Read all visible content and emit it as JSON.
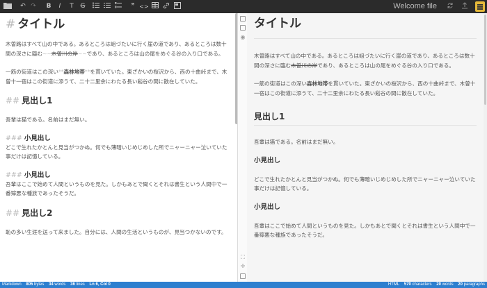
{
  "toolbar": {
    "title": "Welcome file",
    "icons": [
      "folder-icon",
      "undo-icon",
      "redo-icon",
      "bold-icon",
      "italic-icon",
      "heading-icon",
      "strikethrough-icon",
      "unordered-list-icon",
      "ordered-list-icon",
      "checklist-icon",
      "quote-icon",
      "code-icon",
      "table-icon",
      "link-icon",
      "image-icon",
      "sync-icon",
      "publish-icon",
      "menu-icon"
    ],
    "glyphs": {
      "bold": "B",
      "italic": "I",
      "heading": "T",
      "strike": "G",
      "quote": "❞",
      "code": "<>",
      "undo": "↶",
      "redo": "↷"
    }
  },
  "editor": {
    "h1_mark": "#",
    "h1": "タイトル",
    "p1_a": "木曽路はすべて山の中である。あるところは岨づたいに行く崖の道であり、あるところは数十間の深さに臨む",
    "p1_strike_mark_open": "~~",
    "p1_strike": "木曽川の岸",
    "p1_strike_mark_close": "~~",
    "p1_b": "であり、あるところは山の尾をめぐる谷の入り口である。",
    "p2_a": "一筋の街道はこの深い",
    "p2_bold_open": "**",
    "p2_bold": "森林地帯",
    "p2_bold_close": "**",
    "p2_b": "を貫いていた。東ざかいの桜沢から、西の十曲峠まで、木曽十一宿はこの街道に添うて、二十二里余にわたる長い谿谷の間に散在していた。",
    "h2a_mark": "##",
    "h2a": "見出し1",
    "p3": "吾輩は猫である。名前はまだ無い。",
    "h3a_mark": "###",
    "h3a": "小見出し",
    "p4": "どこで生れたかとんと見当がつかぬ。何でも薄暗いじめじめした所でニャーニャー泣いていた事だけは記憶している。",
    "h3b_mark": "###",
    "h3b": "小見出し",
    "p5": "吾輩はここで始めて人間というものを見た。しかもあとで聞くとそれは書生という人間中で一番獰悪な種族であったそうだ。",
    "h2b_mark": "##",
    "h2b": "見出し2",
    "p6": "恥の多い生涯を送って来ました。自分には、人間の生活というものが、見当つかないのです。"
  },
  "preview": {
    "h1": "タイトル",
    "p1_a": "木曽路はすべて山の中である。あるところは岨づたいに行く崖の道であり、あるところは数十間の深さに臨む",
    "p1_strike": "木曽川の岸",
    "p1_b": "であり、あるところは山の尾をめぐる谷の入り口である。",
    "p2_a": "一筋の街道はこの深い",
    "p2_bold": "森林地帯",
    "p2_b": "を貫いていた。東ざかいの桜沢から、西の十曲峠まで、木曽十一宿はこの街道に添うて、二十二里余にわたる長い谿谷の間に散在していた。",
    "h2a": "見出し1",
    "p3": "吾輩は猫である。名前はまだ無い。",
    "h3a": "小見出し",
    "p4": "どこで生れたかとんと見当がつかぬ。何でも薄暗いじめじめした所でニャーニャー泣いていた事だけは記憶している。",
    "h3b": "小見出し",
    "p5": "吾輩はここで始めて人間というものを見た。しかもあとで聞くとそれは書生という人間中で一番獰悪な種族であったそうだ。"
  },
  "statusbar": {
    "mode": "Markdown",
    "bytes_n": "805",
    "bytes_l": "bytes",
    "words_n": "34",
    "words_l": "words",
    "lines_n": "36",
    "lines_l": "lines",
    "cursor": "Ln 6, Col 0",
    "html": "HTML",
    "chars_n": "570",
    "chars_l": "characters",
    "pwords_n": "20",
    "pwords_l": "words",
    "paras_n": "20",
    "paras_l": "paragraphs"
  },
  "colors": {
    "toolbar": "#2b2b2b",
    "statusbar": "#2d7fcf",
    "preview_bg": "#f5f5f5",
    "menu_accent": "#e6b93a"
  }
}
